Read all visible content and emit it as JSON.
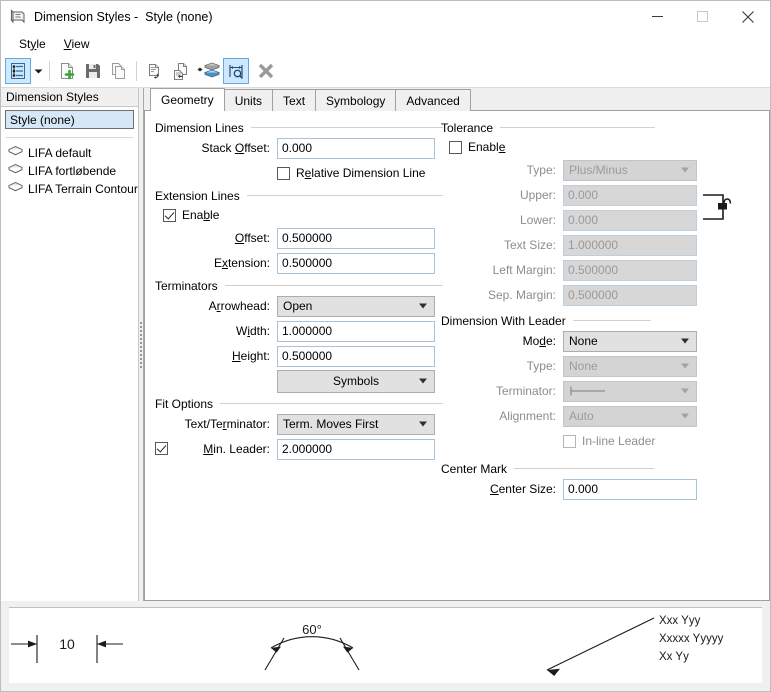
{
  "window": {
    "title": "Dimension Styles -  Style (none)",
    "icon": "dimension-style-icon",
    "minimize_label": "–",
    "maximize_label": "□",
    "close_label": "✕"
  },
  "menu": {
    "items": [
      {
        "label": "Style",
        "mnemonic": "y"
      },
      {
        "label": "View",
        "mnemonic": "V"
      }
    ]
  },
  "toolbar": {
    "buttons": [
      {
        "name": "style-list-button",
        "icon": "style-list-icon",
        "active": true
      },
      {
        "name": "style-list-dropdown",
        "icon": "chevron-down-icon",
        "active": false
      },
      {
        "name": "new-style-button",
        "icon": "new-document-plus-icon",
        "active": false
      },
      {
        "name": "save-style-button",
        "icon": "floppy-save-icon",
        "active": false
      },
      {
        "name": "copy-style-button",
        "icon": "copy-pages-icon",
        "active": false
      },
      {
        "name": "import-style-button",
        "icon": "document-arrow-icon",
        "active": false
      },
      {
        "name": "export-style-button",
        "icon": "document-return-icon",
        "active": false
      },
      {
        "name": "update-from-element-button",
        "icon": "layers-stack-icon",
        "active": false
      },
      {
        "name": "match-dimension-button",
        "icon": "dimension-search-icon",
        "active": true
      },
      {
        "name": "delete-style-button",
        "icon": "delete-x-icon",
        "active": false
      }
    ]
  },
  "sidebar": {
    "header": "Dimension Styles",
    "selected_style": "Style (none)",
    "items": [
      {
        "label": "LIFA default",
        "icon": "style-book-icon"
      },
      {
        "label": "LIFA fortløbende",
        "icon": "style-book-icon"
      },
      {
        "label": "LIFA Terrain Contour E",
        "icon": "style-book-icon"
      }
    ]
  },
  "tabs": [
    {
      "label": "Geometry",
      "selected": true
    },
    {
      "label": "Units",
      "selected": false
    },
    {
      "label": "Text",
      "selected": false
    },
    {
      "label": "Symbology",
      "selected": false
    },
    {
      "label": "Advanced",
      "selected": false
    }
  ],
  "geometry": {
    "dimension_lines": {
      "title": "Dimension Lines",
      "stack_offset_label": "Stack Offset:",
      "stack_offset_value": "0.000",
      "relative_dimension_line_label": "Relative Dimension Line",
      "relative_dimension_line_checked": false
    },
    "extension_lines": {
      "title": "Extension Lines",
      "enable_label": "Enable",
      "enable_checked": true,
      "offset_label": "Offset:",
      "offset_value": "0.500000",
      "extension_label": "Extension:",
      "extension_value": "0.500000"
    },
    "terminators": {
      "title": "Terminators",
      "arrowhead_label": "Arrowhead:",
      "arrowhead_value": "Open",
      "width_label": "Width:",
      "width_value": "1.000000",
      "height_label": "Height:",
      "height_value": "0.500000",
      "symbols_button": "Symbols"
    },
    "fit_options": {
      "title": "Fit Options",
      "text_terminator_label": "Text/Terminator:",
      "text_terminator_value": "Term. Moves First",
      "min_leader_label": "Min. Leader:",
      "min_leader_value": "2.000000",
      "min_leader_checked": true
    },
    "tolerance": {
      "title": "Tolerance",
      "enable_label": "Enable",
      "enable_checked": false,
      "type_label": "Type:",
      "type_value": "Plus/Minus",
      "upper_label": "Upper:",
      "upper_value": "0.000",
      "lower_label": "Lower:",
      "lower_value": "0.000",
      "text_size_label": "Text Size:",
      "text_size_value": "1.000000",
      "left_margin_label": "Left Margin:",
      "left_margin_value": "0.500000",
      "sep_margin_label": "Sep. Margin:",
      "sep_margin_value": "0.500000",
      "link_icon": "unlocked-padlock-icon"
    },
    "dimension_with_leader": {
      "title": "Dimension With Leader",
      "mode_label": "Mode:",
      "mode_value": "None",
      "type_label": "Type:",
      "type_value": "None",
      "terminator_label": "Terminator:",
      "terminator_value": "line-terminator-glyph",
      "alignment_label": "Alignment:",
      "alignment_value": "Auto",
      "inline_leader_label": "In-line Leader",
      "inline_leader_checked": false
    },
    "center_mark": {
      "title": "Center Mark",
      "center_size_label": "Center Size:",
      "center_size_value": "0.000"
    }
  },
  "preview": {
    "linear_value": "10",
    "angular_value": "60°",
    "leader_lines": [
      "Xxx Yyy",
      "Xxxxx Yyyyy",
      "Xx Yy"
    ]
  },
  "colors": {
    "accent": "#cde8ff",
    "accent_border": "#65a9dd",
    "selection": "#d6e8f7",
    "field_border": "#abc1d4",
    "disabled_text": "#8d8d8d",
    "disabled_field": "#d7d7d7",
    "window_bg": "#f0f0f0"
  }
}
